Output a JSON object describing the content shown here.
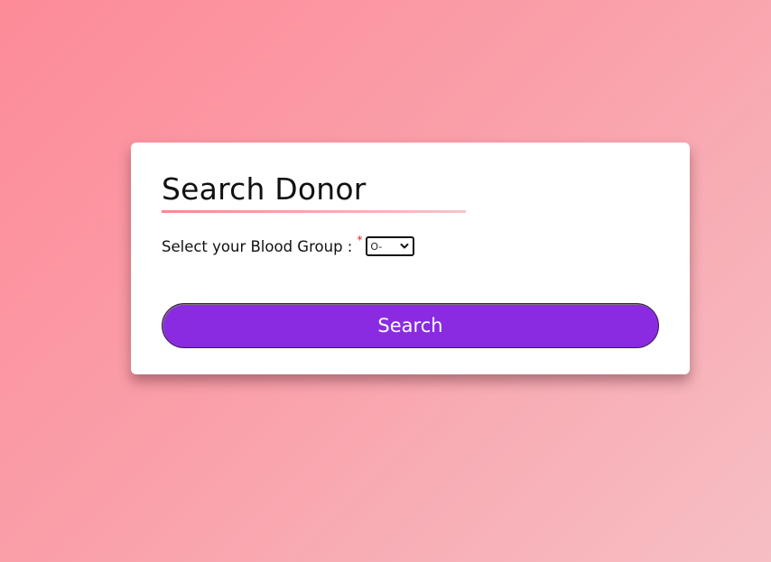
{
  "form": {
    "title": "Search Donor",
    "blood_group_label": "Select your Blood Group :",
    "required_marker": "*",
    "blood_group_selected": "O-",
    "search_button_label": "Search"
  },
  "colors": {
    "accent": "#8a2be2",
    "background_start": "#fd8b98",
    "background_end": "#f6bfc4",
    "required": "#e02020"
  },
  "icons": {
    "select_arrow": "chevron-down-icon"
  }
}
